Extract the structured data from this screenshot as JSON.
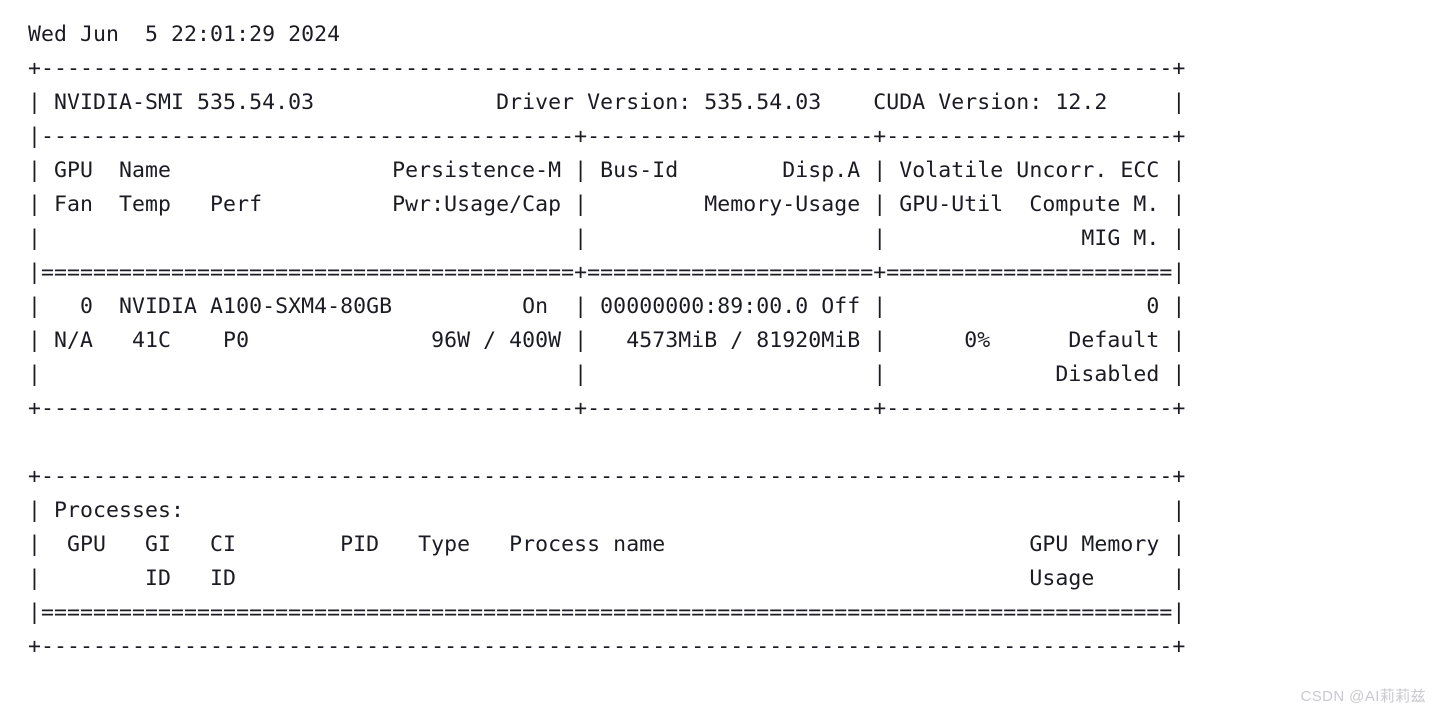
{
  "terminal": {
    "timestamp": "Wed Jun  5 22:01:29 2024",
    "smi_header": {
      "nvidia_smi_version_label": "NVIDIA-SMI 535.54.03",
      "driver_version_label": "Driver Version: 535.54.03",
      "cuda_version_label": "CUDA Version: 12.2"
    },
    "gpu_table": {
      "column_headers_row1": [
        "GPU",
        "Name",
        "Persistence-M",
        "Bus-Id",
        "Disp.A",
        "Volatile Uncorr. ECC"
      ],
      "column_headers_row2": [
        "Fan",
        "Temp",
        "Perf",
        "Pwr:Usage/Cap",
        "Memory-Usage",
        "GPU-Util",
        "Compute M."
      ],
      "column_headers_row3": [
        "MIG M."
      ],
      "rows": [
        {
          "index": "0",
          "name": "NVIDIA A100-SXM4-80GB",
          "persistence_m": "On",
          "bus_id": "00000000:89:00.0",
          "disp_a": "Off",
          "ecc": "0",
          "fan": "N/A",
          "temp": "41C",
          "perf": "P0",
          "pwr_usage_cap": "96W / 400W",
          "memory_usage": "4573MiB / 81920MiB",
          "gpu_util": "0%",
          "compute_m": "Default",
          "mig_m": "Disabled"
        }
      ]
    },
    "processes_table": {
      "title": "Processes:",
      "column_headers_row1": [
        "GPU",
        "GI",
        "CI",
        "PID",
        "Type",
        "Process name",
        "GPU Memory"
      ],
      "column_headers_row2": [
        "ID",
        "ID",
        "Usage"
      ],
      "rows": []
    },
    "lines": [
      "Wed Jun  5 22:01:29 2024",
      "+---------------------------------------------------------------------------------------+",
      "| NVIDIA-SMI 535.54.03              Driver Version: 535.54.03    CUDA Version: 12.2     |",
      "|-----------------------------------------+----------------------+----------------------+",
      "| GPU  Name                 Persistence-M | Bus-Id        Disp.A | Volatile Uncorr. ECC |",
      "| Fan  Temp   Perf          Pwr:Usage/Cap |         Memory-Usage | GPU-Util  Compute M. |",
      "|                                         |                      |               MIG M. |",
      "|=========================================+======================+======================|",
      "|   0  NVIDIA A100-SXM4-80GB          On  | 00000000:89:00.0 Off |                    0 |",
      "| N/A   41C    P0              96W / 400W |   4573MiB / 81920MiB |      0%      Default |",
      "|                                         |                      |             Disabled |",
      "+-----------------------------------------+----------------------+----------------------+",
      "",
      "+---------------------------------------------------------------------------------------+",
      "| Processes:                                                                            |",
      "|  GPU   GI   CI        PID   Type   Process name                            GPU Memory |",
      "|        ID   ID                                                             Usage      |",
      "|=======================================================================================|",
      "+---------------------------------------------------------------------------------------+"
    ]
  },
  "watermark": {
    "text": "CSDN @AI莉莉兹"
  }
}
